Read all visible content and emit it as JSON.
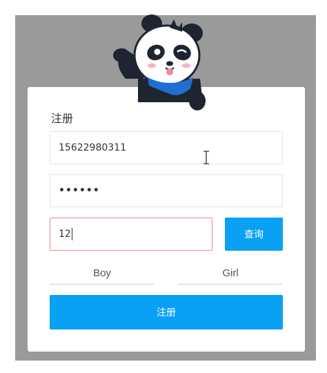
{
  "form": {
    "title": "注册",
    "phone_value": "15622980311",
    "password_value": "••••••",
    "code_value": "12",
    "query_label": "查询",
    "gender_boy": "Boy",
    "gender_girl": "Girl",
    "submit_label": "注册"
  },
  "colors": {
    "primary": "#0aa1f4",
    "error_border": "#f08a8a",
    "backdrop": "#9a9a9a"
  },
  "icons": {
    "mascot": "panda-mascot",
    "cursor": "text-cursor-icon"
  }
}
